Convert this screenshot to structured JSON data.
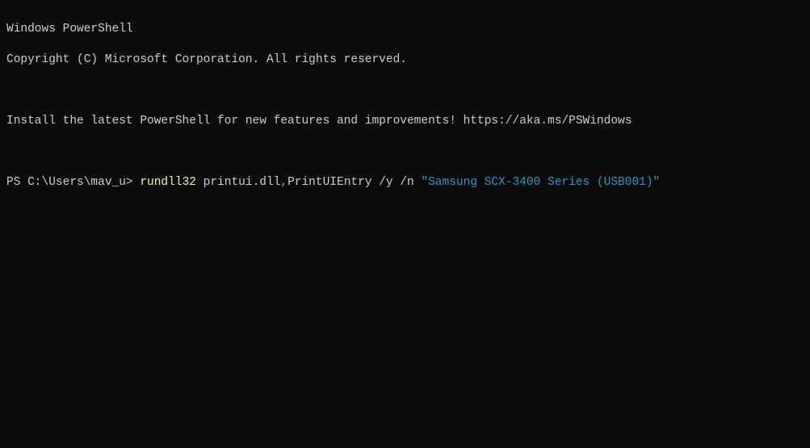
{
  "header": {
    "line1": "Windows PowerShell",
    "line2": "Copyright (C) Microsoft Corporation. All rights reserved."
  },
  "install_msg": "Install the latest PowerShell for new features and improvements! https://aka.ms/PSWindows",
  "prompt": {
    "prefix": "PS C:\\Users\\mav_u> ",
    "command": "rundll32",
    "space1": " ",
    "arg1": "printui.dll",
    "comma": ",",
    "arg2": "PrintUIEntry /y /n ",
    "string": "\"Samsung SCX-3400 Series (USB001)\""
  }
}
